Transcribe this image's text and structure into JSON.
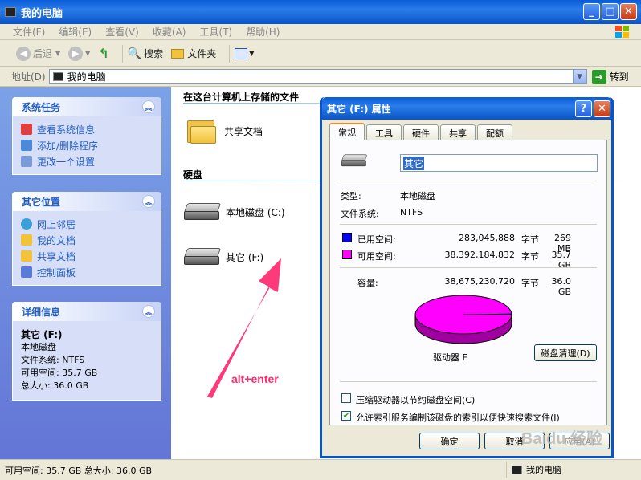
{
  "window": {
    "title": "我的电脑"
  },
  "menu": [
    "文件(F)",
    "编辑(E)",
    "查看(V)",
    "收藏(A)",
    "工具(T)",
    "帮助(H)"
  ],
  "toolbar": {
    "back": "后退",
    "search": "搜索",
    "folders": "文件夹"
  },
  "address": {
    "label": "地址(D)",
    "value": "我的电脑",
    "go": "转到"
  },
  "left": {
    "tasks": {
      "title": "系统任务",
      "items": [
        "查看系统信息",
        "添加/删除程序",
        "更改一个设置"
      ]
    },
    "places": {
      "title": "其它位置",
      "items": [
        "网上邻居",
        "我的文档",
        "共享文档",
        "控制面板"
      ]
    },
    "details": {
      "title": "详细信息",
      "name": "其它 (F:)",
      "type": "本地磁盘",
      "fs": "文件系统: NTFS",
      "free": "可用空间: 35.7 GB",
      "total": "总大小: 36.0 GB"
    }
  },
  "right": {
    "stored_title": "在这台计算机上存储的文件",
    "shared_docs": "共享文档",
    "hdd_title": "硬盘",
    "drive_c": "本地磁盘 (C:)",
    "drive_f": "其它 (F:)"
  },
  "status": {
    "text": "可用空间: 35.7 GB 总大小: 36.0 GB",
    "location": "我的电脑"
  },
  "dialog": {
    "title": "其它 (F:) 属性",
    "tabs": [
      "常规",
      "工具",
      "硬件",
      "共享",
      "配额"
    ],
    "name_value": "其它",
    "type_label": "类型:",
    "type_value": "本地磁盘",
    "fs_label": "文件系统:",
    "fs_value": "NTFS",
    "used_label": "已用空间:",
    "used_bytes": "283,045,888",
    "used_unit": "字节",
    "used_size": "269 MB",
    "free_label": "可用空间:",
    "free_bytes": "38,392,184,832",
    "free_unit": "字节",
    "free_size": "35.7 GB",
    "cap_label": "容量:",
    "cap_bytes": "38,675,230,720",
    "cap_unit": "字节",
    "cap_size": "36.0 GB",
    "drive_label": "驱动器 F",
    "cleanup": "磁盘清理(D)",
    "compress": "压缩驱动器以节约磁盘空间(C)",
    "index": "允许索引服务编制该磁盘的索引以便快速搜索文件(I)",
    "ok": "确定",
    "cancel": "取消",
    "apply": "应用(A)",
    "used_color": "#0000ff",
    "free_color": "#ff00ff",
    "used_fraction": 0.0073
  },
  "annotation": "alt+enter",
  "watermark": "Baidu 经验"
}
